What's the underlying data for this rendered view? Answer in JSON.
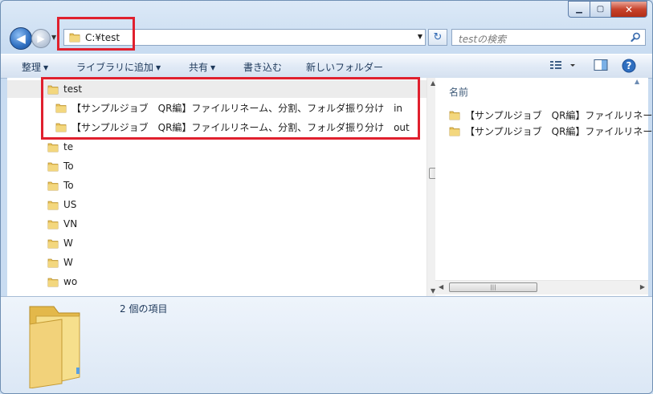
{
  "window": {
    "controls": {
      "minimize": "▁",
      "maximize": "▢",
      "close": "✕"
    }
  },
  "nav": {
    "back": "◀",
    "forward": "▶",
    "history": "▼",
    "address": "C:¥test",
    "address_dropdown": "▼",
    "refresh": "↻",
    "search_placeholder": "testの検索"
  },
  "toolbar": {
    "organize": "整理",
    "include_in_library": "ライブラリに追加",
    "share": "共有",
    "burn": "書き込む",
    "new_folder": "新しいフォルダー",
    "dropdown_arrow": "▼"
  },
  "tree": {
    "root": {
      "label": "test"
    },
    "children": [
      {
        "label": "【サンプルジョブ　QR編】ファイルリネーム、分割、フォルダ振り分け　in"
      },
      {
        "label": "【サンプルジョブ　QR編】ファイルリネーム、分割、フォルダ振り分け　out"
      }
    ],
    "siblings": [
      {
        "label": "te"
      },
      {
        "label": "To"
      },
      {
        "label": "To"
      },
      {
        "label": "US"
      },
      {
        "label": "VN"
      },
      {
        "label": "W"
      },
      {
        "label": "W"
      },
      {
        "label": "wo"
      }
    ]
  },
  "content": {
    "column_header": "名前",
    "sort_indicator": "▲",
    "items": [
      {
        "label": "【サンプルジョブ　QR編】ファイルリネーム、分割、フォルダ振り分け　in"
      },
      {
        "label": "【サンプルジョブ　QR編】ファイルリネーム、分割、フォルダ振り分け　out"
      }
    ],
    "scroll_grip": "|||"
  },
  "scroll": {
    "up": "▲",
    "down": "▼",
    "left": "◀",
    "right": "▶"
  },
  "details": {
    "item_count": "2 個の項目"
  },
  "colors": {
    "annotation": "#e0202e",
    "folder": "#e8c25a"
  }
}
